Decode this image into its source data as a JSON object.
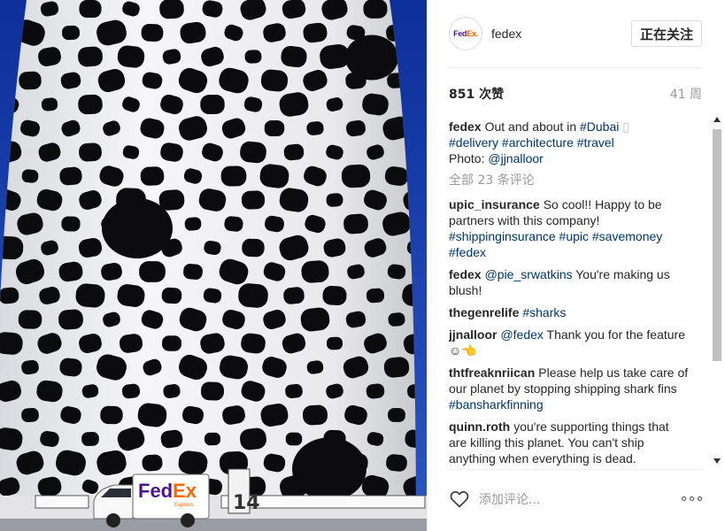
{
  "header": {
    "avatar_logo_part1": "Fed",
    "avatar_logo_part2": "Ex.",
    "username": "fedex",
    "follow_label": "正在关注"
  },
  "meta": {
    "likes": "851 次赞",
    "age": "41 周"
  },
  "caption": {
    "author": "fedex",
    "line1": "Out and about in ",
    "tag_dubai": "#Dubai",
    "glyph": " ▯",
    "tag_delivery": "#delivery",
    "tag_architecture": "#architecture",
    "tag_travel": "#travel",
    "photo_label": "Photo: ",
    "photo_credit": "@jjnalloor"
  },
  "all_comments": "全部 23 条评论",
  "comments": [
    {
      "author": "upic_insurance",
      "text": "So cool!! Happy to be partners with this company!",
      "tags": "#shippinginsurance #upic #savemoney #fedex"
    },
    {
      "author": "fedex",
      "mention": "@pie_srwatkins",
      "text": " You're making us blush!"
    },
    {
      "author": "thegenrelife",
      "tags": "#sharks"
    },
    {
      "author": "jjnalloor",
      "mention": "@fedex",
      "text": " Thank you for the feature ☺👈"
    },
    {
      "author": "thtfreaknriican",
      "text": "Please help us take care of our planet by stopping shipping shark fins ",
      "tags": "#bansharkfinning"
    },
    {
      "author": "quinn.roth",
      "text": "you're supporting things that are killing this planet. You can't ship anything when everything is dead."
    }
  ],
  "footer": {
    "add_comment_placeholder": "添加评论..."
  },
  "photo": {
    "truck_brand_part1": "Fed",
    "truck_brand_part2": "Ex",
    "truck_sub": "Express",
    "sign_text": "14"
  },
  "icons": {
    "heart": "heart-icon",
    "more": "more-options-icon"
  },
  "colors": {
    "sky": "#1b3fa6",
    "fedex_purple": "#4d148c",
    "fedex_orange": "#ff6600",
    "hashtag": "#003569"
  }
}
